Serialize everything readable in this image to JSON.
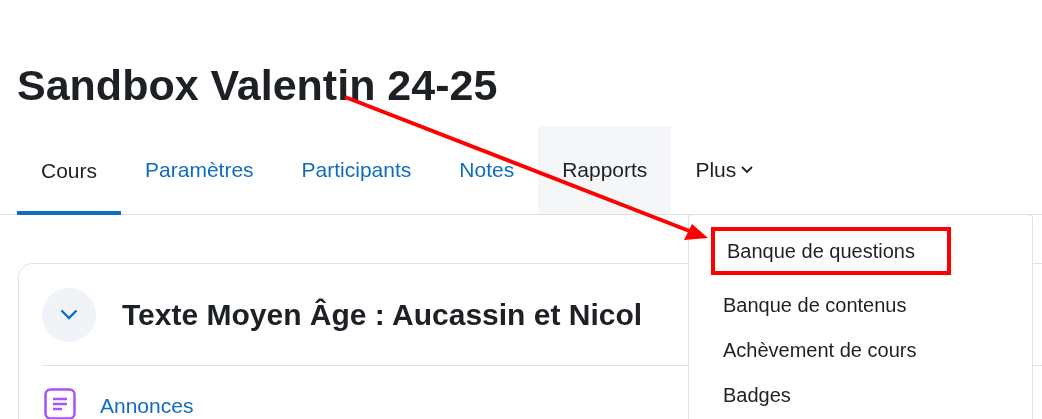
{
  "page_title": "Sandbox Valentin 24-25",
  "tabs": [
    {
      "label": "Cours",
      "selected": true,
      "hovered": false,
      "kind": "link"
    },
    {
      "label": "Paramètres",
      "selected": false,
      "hovered": false,
      "kind": "link"
    },
    {
      "label": "Participants",
      "selected": false,
      "hovered": false,
      "kind": "link"
    },
    {
      "label": "Notes",
      "selected": false,
      "hovered": false,
      "kind": "link"
    },
    {
      "label": "Rapports",
      "selected": false,
      "hovered": true,
      "kind": "link"
    },
    {
      "label": "Plus",
      "selected": false,
      "hovered": false,
      "kind": "menu",
      "expanded": true
    }
  ],
  "menu": {
    "items": [
      {
        "label": "Banque de questions",
        "annotated": true
      },
      {
        "label": "Banque de contenus",
        "annotated": false
      },
      {
        "label": "Achèvement de cours",
        "annotated": false
      },
      {
        "label": "Badges",
        "annotated": false
      }
    ]
  },
  "section": {
    "title": "Texte Moyen Âge : Aucassin et Nicol",
    "expanded": true,
    "activities": [
      {
        "label": "Annonces"
      }
    ]
  }
}
